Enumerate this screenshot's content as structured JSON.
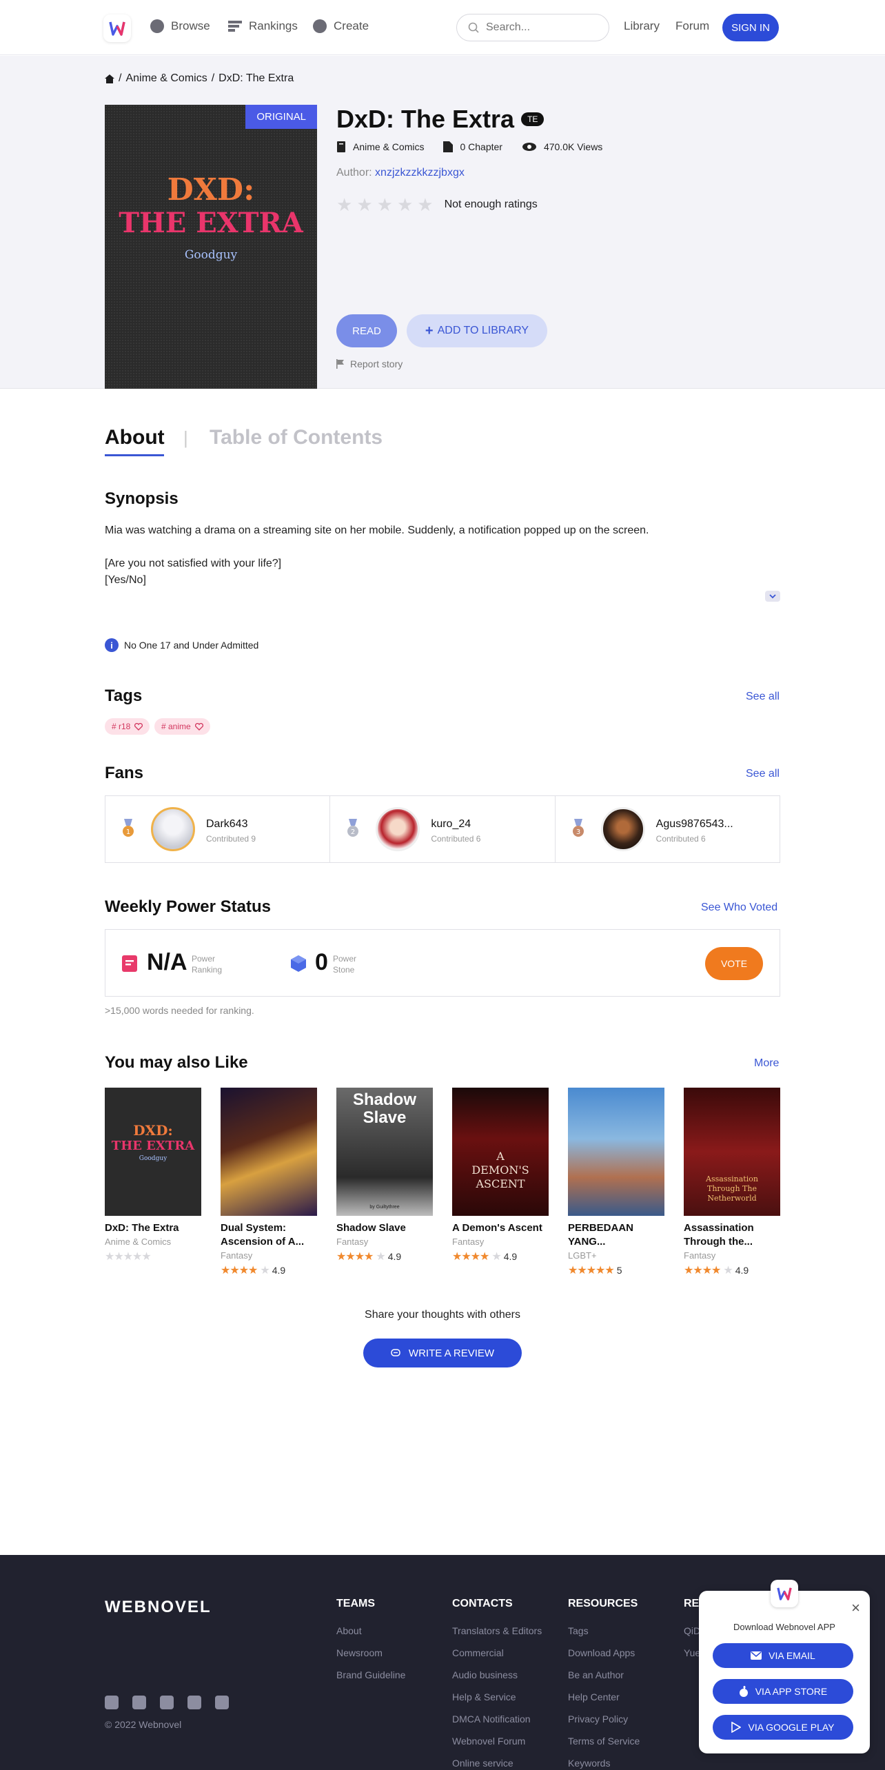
{
  "nav": {
    "browse": "Browse",
    "rankings": "Rankings",
    "create": "Create",
    "search_placeholder": "Search...",
    "library": "Library",
    "forum": "Forum",
    "signin": "SIGN IN"
  },
  "breadcrumb": {
    "sep1": "/",
    "category": "Anime & Comics",
    "sep2": "/",
    "current": "DxD: The Extra"
  },
  "book": {
    "badge": "ORIGINAL",
    "cover_line1": "DXD:",
    "cover_line2": "THE EXTRA",
    "cover_author": "Goodguy",
    "title": "DxD: The Extra",
    "title_badge": "TE",
    "category": "Anime & Comics",
    "chapters": "0 Chapter",
    "views": "470.0K Views",
    "author_label": "Author:",
    "author": "xnzjzkzzkkzzjbxgx",
    "rating_text": "Not enough ratings",
    "read": "READ",
    "add_library": "ADD TO LIBRARY",
    "report": "Report story"
  },
  "tabs": {
    "about": "About",
    "sep": "|",
    "toc": "Table of Contents"
  },
  "synopsis": {
    "heading": "Synopsis",
    "line1": "Mia was watching a drama on a streaming site on her mobile. Suddenly, a notification popped up on the screen.",
    "line2": "[Are you not satisfied with your life?]",
    "line3": "[Yes/No]",
    "warning": "No One 17 and Under Admitted"
  },
  "tags": {
    "heading": "Tags",
    "see_all": "See all",
    "items": [
      "# r18",
      "# anime"
    ]
  },
  "fans": {
    "heading": "Fans",
    "see_all": "See all",
    "items": [
      {
        "name": "Dark643",
        "contrib": "Contributed 9",
        "medal": "#e89a3a"
      },
      {
        "name": "kuro_24",
        "contrib": "Contributed 6",
        "medal": "#b8bcc8"
      },
      {
        "name": "Agus9876543...",
        "contrib": "Contributed 6",
        "medal": "#c88a6a"
      }
    ]
  },
  "power": {
    "heading": "Weekly Power Status",
    "see_voted": "See Who Voted",
    "ranking_value": "N/A",
    "ranking_label1": "Power",
    "ranking_label2": "Ranking",
    "stone_value": "0",
    "stone_label1": "Power",
    "stone_label2": "Stone",
    "vote": "VOTE",
    "note": ">15,000 words needed for ranking."
  },
  "recommend": {
    "heading": "You may also Like",
    "more": "More",
    "items": [
      {
        "title1": "DxD: The Extra",
        "title2": "",
        "genre": "Anime & Comics",
        "rating": "",
        "stars": 0
      },
      {
        "title1": "Dual System:",
        "title2": "Ascension of A...",
        "genre": "Fantasy",
        "rating": "4.9",
        "stars": 4
      },
      {
        "title1": "Shadow Slave",
        "title2": "",
        "genre": "Fantasy",
        "rating": "4.9",
        "stars": 4
      },
      {
        "title1": "A Demon's Ascent",
        "title2": "",
        "genre": "Fantasy",
        "rating": "4.9",
        "stars": 4
      },
      {
        "title1": "PERBEDAAN",
        "title2": "YANG...",
        "genre": "LGBT+",
        "rating": "5",
        "stars": 5
      },
      {
        "title1": "Assassination",
        "title2": "Through the...",
        "genre": "Fantasy",
        "rating": "4.9",
        "stars": 4
      }
    ],
    "covers": {
      "c1a": "DXD:",
      "c1b": "THE EXTRA",
      "c1c": "Goodguy",
      "c3a": "Shadow",
      "c3b": "Slave",
      "c3c": "by Guiltythree",
      "c4a": "A",
      "c4b": "DEMON'S",
      "c4c": "ASCENT",
      "c6a": "Assassination",
      "c6b": "Through The",
      "c6c": "Netherworld"
    }
  },
  "review": {
    "share": "Share your thoughts with others",
    "button": "WRITE A REVIEW"
  },
  "footer": {
    "logo": "WEBNOVEL",
    "copyright": "© 2022 Webnovel",
    "teams": {
      "heading": "TEAMS",
      "links": [
        "About",
        "Newsroom",
        "Brand Guideline"
      ]
    },
    "contacts": {
      "heading": "CONTACTS",
      "links": [
        "Translators & Editors",
        "Commercial",
        "Audio business",
        "Help & Service",
        "DMCA Notification",
        "Webnovel Forum",
        "Online service"
      ]
    },
    "resources": {
      "heading": "RESOURCES",
      "links": [
        "Tags",
        "Download Apps",
        "Be an Author",
        "Help Center",
        "Privacy Policy",
        "Terms of Service",
        "Keywords"
      ]
    },
    "referrals": {
      "heading": "RE",
      "links": [
        "QiD",
        "Yue"
      ]
    }
  },
  "popup": {
    "title": "Download Webnovel APP",
    "email": "VIA EMAIL",
    "appstore": "VIA APP STORE",
    "googleplay": "VIA GOOGLE PLAY"
  }
}
